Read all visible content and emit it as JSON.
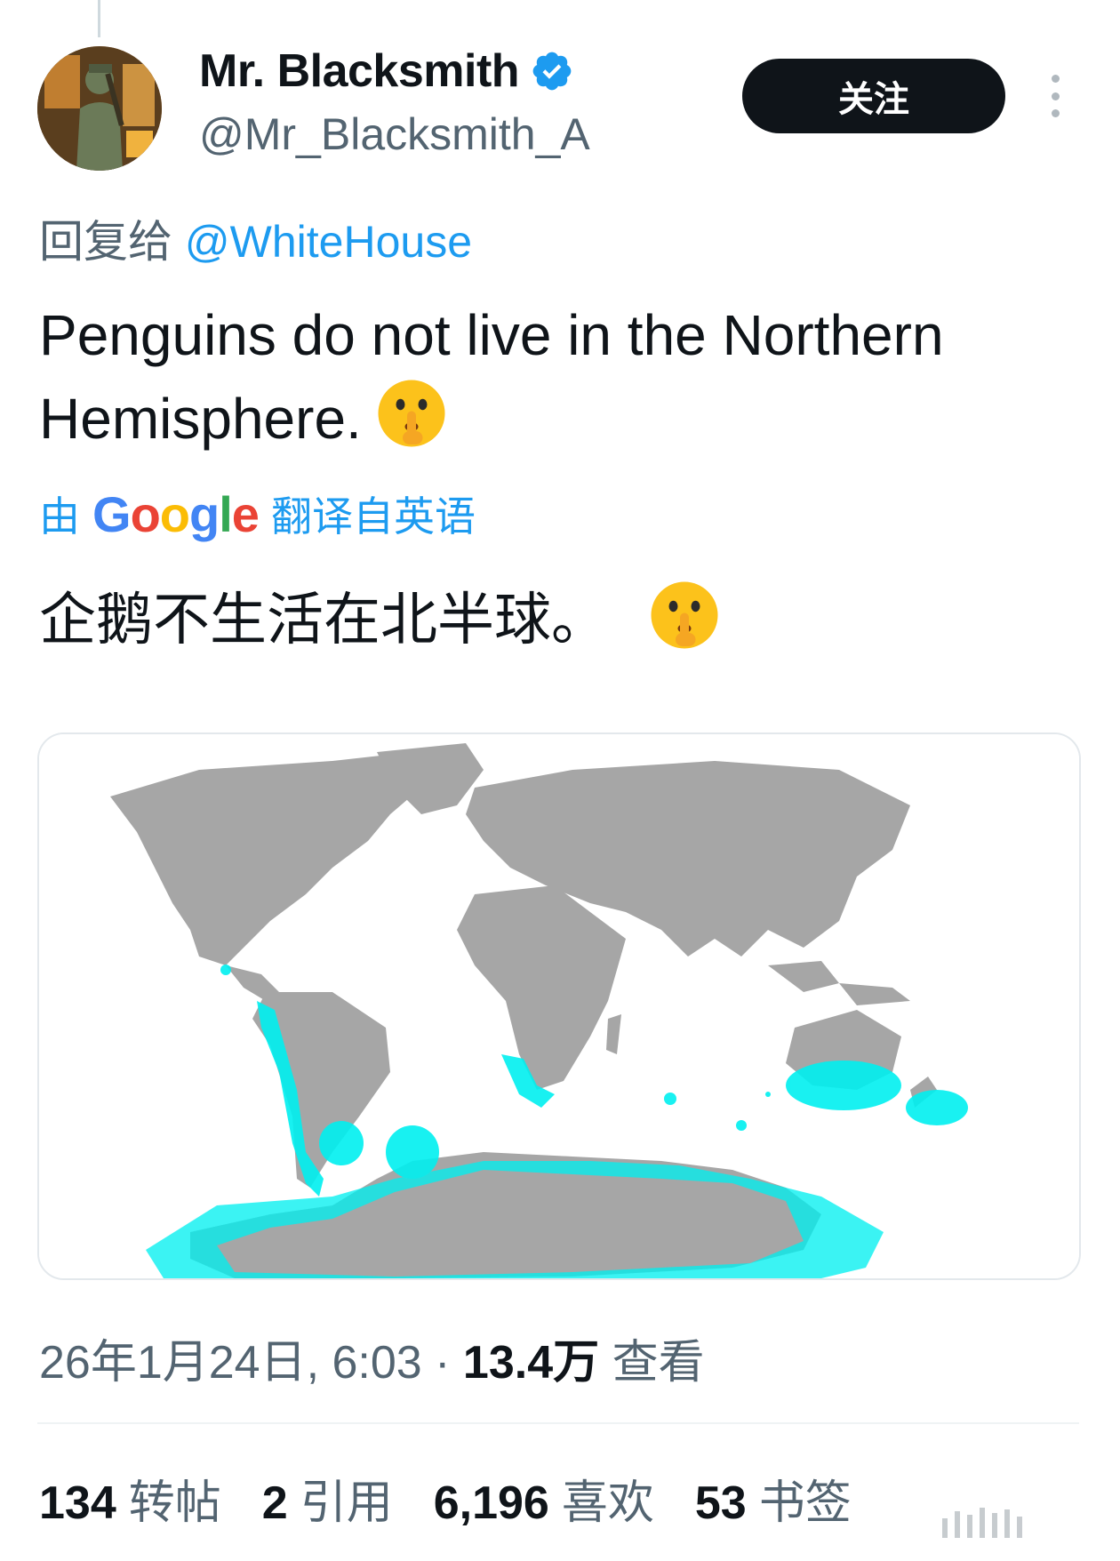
{
  "author": {
    "display_name": "Mr. Blacksmith",
    "handle": "@Mr_Blacksmith_A",
    "verified": true,
    "avatar_icon": "avatar-blacksmith-icon"
  },
  "follow_label": "关注",
  "more_icon": "more-vertical-icon",
  "reply": {
    "prefix": "回复给",
    "mention": "@WhiteHouse"
  },
  "tweet": {
    "text": "Penguins do not live in the Northern Hemisphere.",
    "emoji": "shushing-face-icon"
  },
  "translation": {
    "prefix": "由",
    "brand": "Google",
    "suffix": "翻译自英语",
    "text": "企鹅不生活在北半球。"
  },
  "media": {
    "type": "map",
    "description_icon": "world-map-penguin-range",
    "land_color": "#a6a6a6",
    "range_color": "#00f0f0"
  },
  "meta": {
    "date": "26年1月24日, 6:03",
    "separator": " · ",
    "views_count": "13.4万",
    "views_label": "查看"
  },
  "stats": [
    {
      "count": "134",
      "label": "转帖"
    },
    {
      "count": "2",
      "label": "引用"
    },
    {
      "count": "6,196",
      "label": "喜欢"
    },
    {
      "count": "53",
      "label": "书签"
    }
  ],
  "colors": {
    "accent": "#1d9bf0",
    "text": "#0f1419",
    "secondary": "#536471"
  }
}
